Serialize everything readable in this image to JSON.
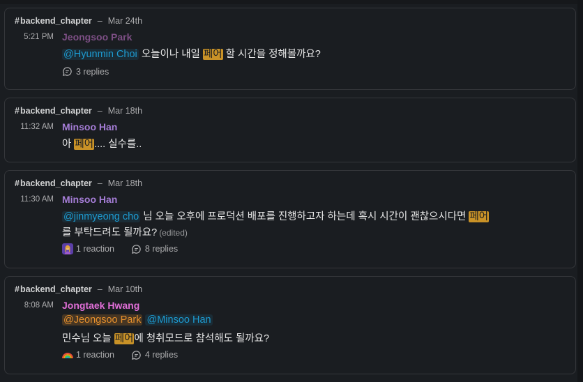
{
  "colors": {
    "author_jeongsoo": "#7d4f85",
    "author_minsoo": "#a57dd6",
    "author_jongtaek": "#e16fd8",
    "mention": "#1d9bd1",
    "highlight": "#c99227"
  },
  "results": [
    {
      "channel": "backend_chapter",
      "date": "Mar 24th",
      "time": "5:21 PM",
      "author": "Jeongsoo Park",
      "mention1": "@Hyunmin Choi",
      "text_a": " 오늘이나 내일 ",
      "highlight": "페어",
      "text_b": " 할 시간을 정해볼까요?",
      "replies": "3 replies"
    },
    {
      "channel": "backend_chapter",
      "date": "Mar 18th",
      "time": "11:32 AM",
      "author": "Minsoo Han",
      "text_a": "아 ",
      "highlight": "페어",
      "text_b": ".... 실수를.."
    },
    {
      "channel": "backend_chapter",
      "date": "Mar 18th",
      "time": "11:30 AM",
      "author": "Minsoo Han",
      "mention1": "@jinmyeong cho",
      "text_a": " 님 오늘 오후에 프로덕션 배포를 진행하고자 하는데 혹시 시간이 괜찮으시다면 ",
      "highlight": "페어",
      "text_line2": "를 부탁드려도 될까요?",
      "edited": "(edited)",
      "reaction": "1 reaction",
      "replies": "8 replies",
      "reaction_icon": "woman-emoji-icon"
    },
    {
      "channel": "backend_chapter",
      "date": "Mar 10th",
      "time": "8:08 AM",
      "author": "Jongtaek Hwang",
      "mention1": "@Jeongsoo Park",
      "mention2": "@Minsoo Han",
      "text_a": "민수님 오늘 ",
      "highlight": "페어",
      "text_b": "에 청취모드로 참석해도 될까요?",
      "reaction": "1 reaction",
      "replies": "4 replies",
      "reaction_icon": "rainbow-emoji-icon"
    }
  ]
}
